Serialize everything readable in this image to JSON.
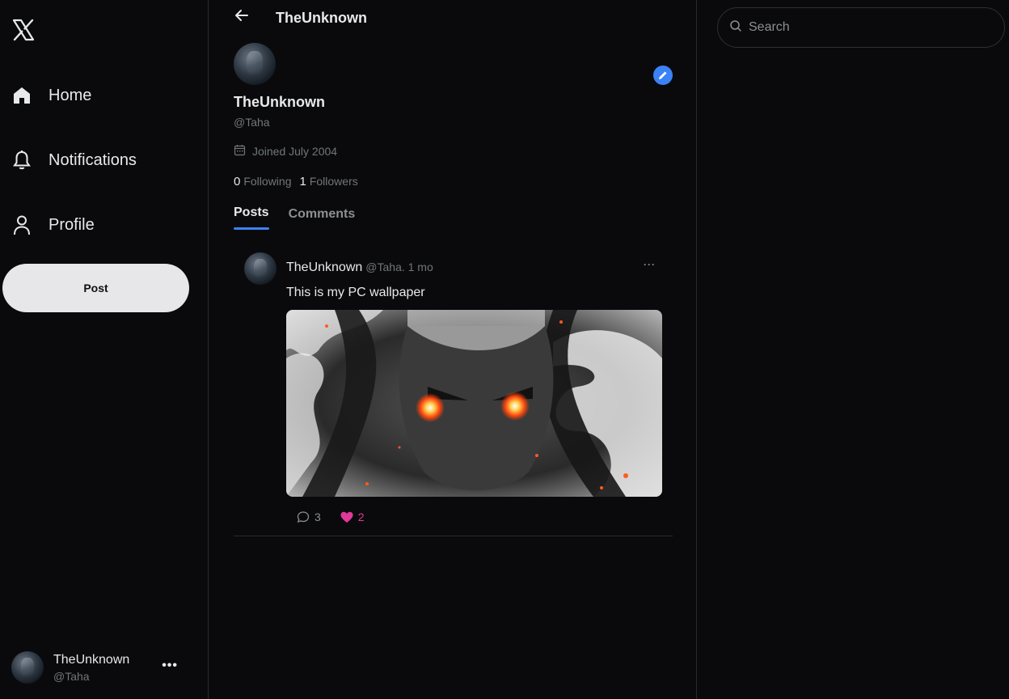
{
  "sidebar": {
    "logo_icon": "x-logo-icon",
    "nav": [
      {
        "label": "Home",
        "icon": "home-icon"
      },
      {
        "label": "Notifications",
        "icon": "bell-icon"
      },
      {
        "label": "Profile",
        "icon": "user-icon"
      }
    ],
    "post_button": "Post",
    "account": {
      "name": "TheUnknown",
      "handle": "@Taha",
      "more": "•••"
    }
  },
  "header": {
    "title": "TheUnknown",
    "back_icon": "arrow-left-icon"
  },
  "profile": {
    "name": "TheUnknown",
    "handle": "@Taha",
    "joined": "Joined July 2004",
    "following_count": "0",
    "following_label": "Following",
    "followers_count": "1",
    "followers_label": "Followers",
    "edit_icon": "pencil-icon"
  },
  "tabs": [
    {
      "label": "Posts",
      "active": true
    },
    {
      "label": "Comments",
      "active": false
    }
  ],
  "post": {
    "author": "TheUnknown",
    "meta": "@Taha. 1 mo",
    "more": "···",
    "text": "This is my PC wallpaper",
    "image_icon": "anime-wallpaper-image",
    "comments": "3",
    "likes": "2"
  },
  "search": {
    "placeholder": "Search"
  },
  "colors": {
    "accent": "#3b82f6",
    "like": "#e0399a",
    "background": "#0a0a0c",
    "border": "#2a2a2e"
  }
}
